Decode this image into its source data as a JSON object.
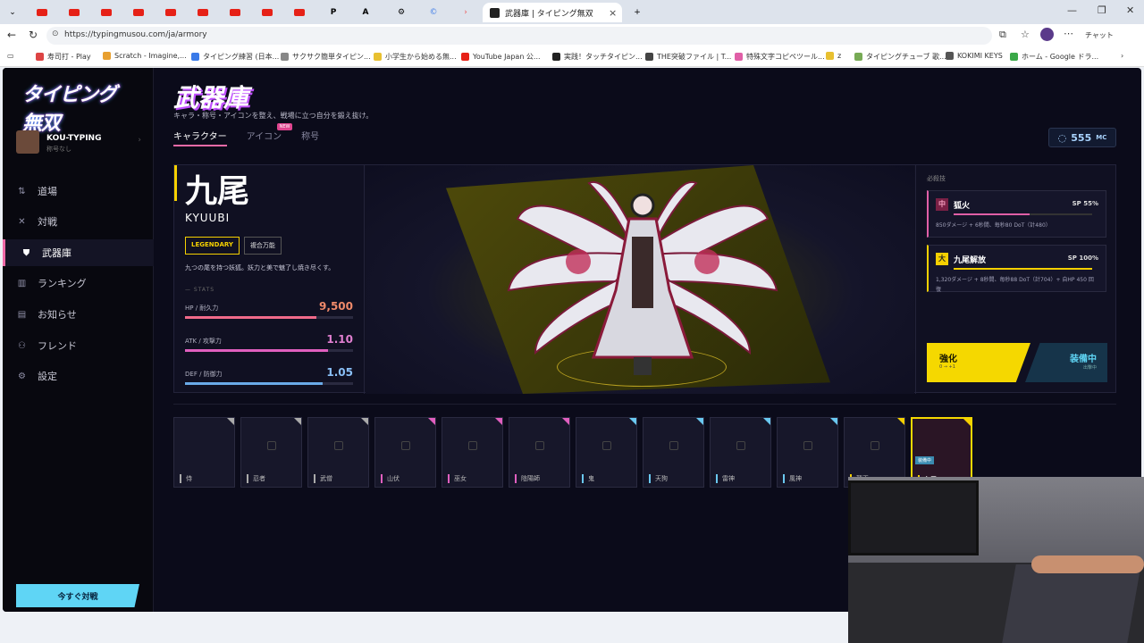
{
  "browser": {
    "active_tab_title": "武器庫 | タイピング無双",
    "url": "https://typingmusou.com/ja/armory",
    "bookmarks": [
      "寿司打 - Play",
      "Scratch - Imagine,...",
      "タイピング練習 (日本...",
      "サクサク簡単タイピン...",
      "小学生から始める無...",
      "YouTube Japan 公...",
      "実践！タッチタイピン...",
      "THE突破ファイル | T...",
      "特殊文字コピペツール...",
      "z",
      "タイピングチューブ 歌...",
      "KOKIMI KEYS",
      "ホーム - Google ドラ..."
    ],
    "profile_button": "チャット"
  },
  "sidebar": {
    "logo": "タイピング無双",
    "user_name": "KOU-TYPING",
    "user_sub": "称号なし",
    "items": [
      {
        "label": "道場",
        "icon": "dojo-icon"
      },
      {
        "label": "対戦",
        "icon": "battle-icon"
      },
      {
        "label": "武器庫",
        "icon": "shield-icon"
      },
      {
        "label": "ランキング",
        "icon": "ranking-icon"
      },
      {
        "label": "お知らせ",
        "icon": "news-icon"
      },
      {
        "label": "フレンド",
        "icon": "friends-icon"
      },
      {
        "label": "設定",
        "icon": "gear-icon"
      }
    ],
    "cta": "今すぐ対戦"
  },
  "header": {
    "title": "武器庫",
    "subtitle": "キャラ・称号・アイコンを整え、戦場に立つ自分を鍛え抜け。",
    "tabs": [
      "キャラクター",
      "アイコン",
      "称号"
    ],
    "new_badge": "NEW",
    "currency_value": "555",
    "currency_unit": "MC"
  },
  "character": {
    "name": "九尾",
    "name_en": "KYUUBI",
    "rarity": "LEGENDARY",
    "type": "複合万能",
    "description": "九つの尾を持つ妖狐。妖力と美で魅了し焼き尽くす。",
    "stats_label": "STATS",
    "stats": [
      {
        "label": "HP / 耐久力",
        "value": "9,500",
        "fill": 0.78,
        "color": "#f06a8a"
      },
      {
        "label": "ATK / 攻撃力",
        "value": "1.10",
        "fill": 0.85,
        "color": "#e05fbf"
      },
      {
        "label": "DEF / 防御力",
        "value": "1.05",
        "fill": 0.82,
        "color": "#6aaae8"
      }
    ]
  },
  "skills": {
    "header": "必殺技",
    "list": [
      {
        "level": "中",
        "name": "狐火",
        "sp": "SP 55%",
        "fill": 0.55,
        "desc": "850ダメージ + 6秒間、毎秒80 DoT（計480）",
        "color": "#e05fa7"
      },
      {
        "level": "大",
        "name": "九尾解放",
        "sp": "SP 100%",
        "fill": 1.0,
        "desc": "1,320ダメージ + 8秒間、毎秒88 DoT（計704）+ 自HP 450 回復",
        "color": "#f5d000"
      }
    ],
    "enhance_label": "強化",
    "enhance_sub": "0 → +1",
    "equipped_label": "装備中",
    "equipped_sub": "出撃中"
  },
  "roster": [
    {
      "name": "侍",
      "color": "#aaaaaa",
      "locked": false
    },
    {
      "name": "忍者",
      "color": "#aaaaaa",
      "locked": true
    },
    {
      "name": "武僧",
      "color": "#aaaaaa",
      "locked": true
    },
    {
      "name": "山伏",
      "color": "#e05fbf",
      "locked": true
    },
    {
      "name": "巫女",
      "color": "#e05fbf",
      "locked": true
    },
    {
      "name": "陰陽師",
      "color": "#e05fbf",
      "locked": true
    },
    {
      "name": "鬼",
      "color": "#6ac8f0",
      "locked": true
    },
    {
      "name": "天狗",
      "color": "#6ac8f0",
      "locked": true
    },
    {
      "name": "雷神",
      "color": "#6ac8f0",
      "locked": true
    },
    {
      "name": "風神",
      "color": "#6ac8f0",
      "locked": true
    },
    {
      "name": "龍王",
      "color": "#f5d000",
      "locked": true
    },
    {
      "name": "九尾",
      "color": "#f5d000",
      "locked": false,
      "selected": true,
      "badge": "装備中"
    }
  ]
}
